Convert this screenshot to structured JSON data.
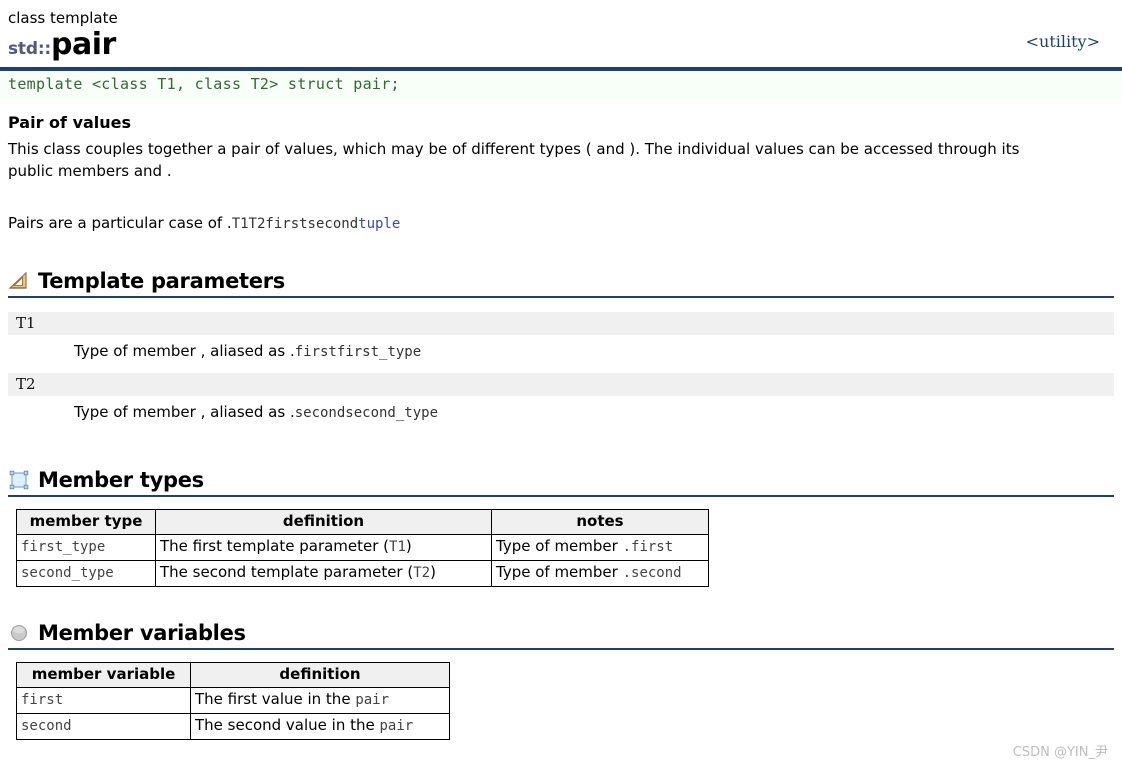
{
  "header": {
    "kicker": "class template",
    "namespace": "std::",
    "name": "pair",
    "include": "<utility>"
  },
  "declaration": "template <class T1, class T2> struct pair;",
  "overview": {
    "subhead": "Pair of values",
    "paragraph1": "This class couples together a pair of values, which may be of different types ( and ). The individual values can be accessed through its public members and .",
    "paragraph2_prefix": "Pairs are a particular case of .",
    "paragraph2_code": "T1T2firstsecond",
    "paragraph2_link": "tuple"
  },
  "sections": {
    "template_parameters": {
      "icon": "triangle-ruler-icon",
      "title": "Template parameters",
      "params": [
        {
          "name": "T1",
          "desc_prefix": "Type of member , aliased as .",
          "desc_code": "firstfirst_type"
        },
        {
          "name": "T2",
          "desc_prefix": "Type of member , aliased as .",
          "desc_code": "secondsecond_type"
        }
      ]
    },
    "member_types": {
      "icon": "selection-box-icon",
      "title": "Member types",
      "columns": [
        "member type",
        "definition",
        "notes"
      ],
      "rows": [
        {
          "type": "first_type",
          "definition_text": "The first template parameter (",
          "definition_code": "T1",
          "definition_suffix": ")",
          "notes_text": "Type of member ",
          "notes_code": ".first"
        },
        {
          "type": "second_type",
          "definition_text": "The second template parameter (",
          "definition_code": "T2",
          "definition_suffix": ")",
          "notes_text": "Type of member ",
          "notes_code": ".second"
        }
      ]
    },
    "member_variables": {
      "icon": "gray-sphere-icon",
      "title": "Member variables",
      "columns": [
        "member variable",
        "definition"
      ],
      "rows": [
        {
          "variable": "first",
          "definition_text": "The first value in the ",
          "definition_code": "pair"
        },
        {
          "variable": "second",
          "definition_text": "The second value in the ",
          "definition_code": "pair"
        }
      ]
    }
  },
  "watermark": "CSDN @YIN_尹",
  "colors": {
    "accent_navy": "#1d3f73",
    "namespace_purple": "#56577d",
    "code_green": "#2f6b33",
    "code_bg": "#f7fff8",
    "link_blue": "#3b48a8",
    "row_gray": "#f0f0f0"
  }
}
